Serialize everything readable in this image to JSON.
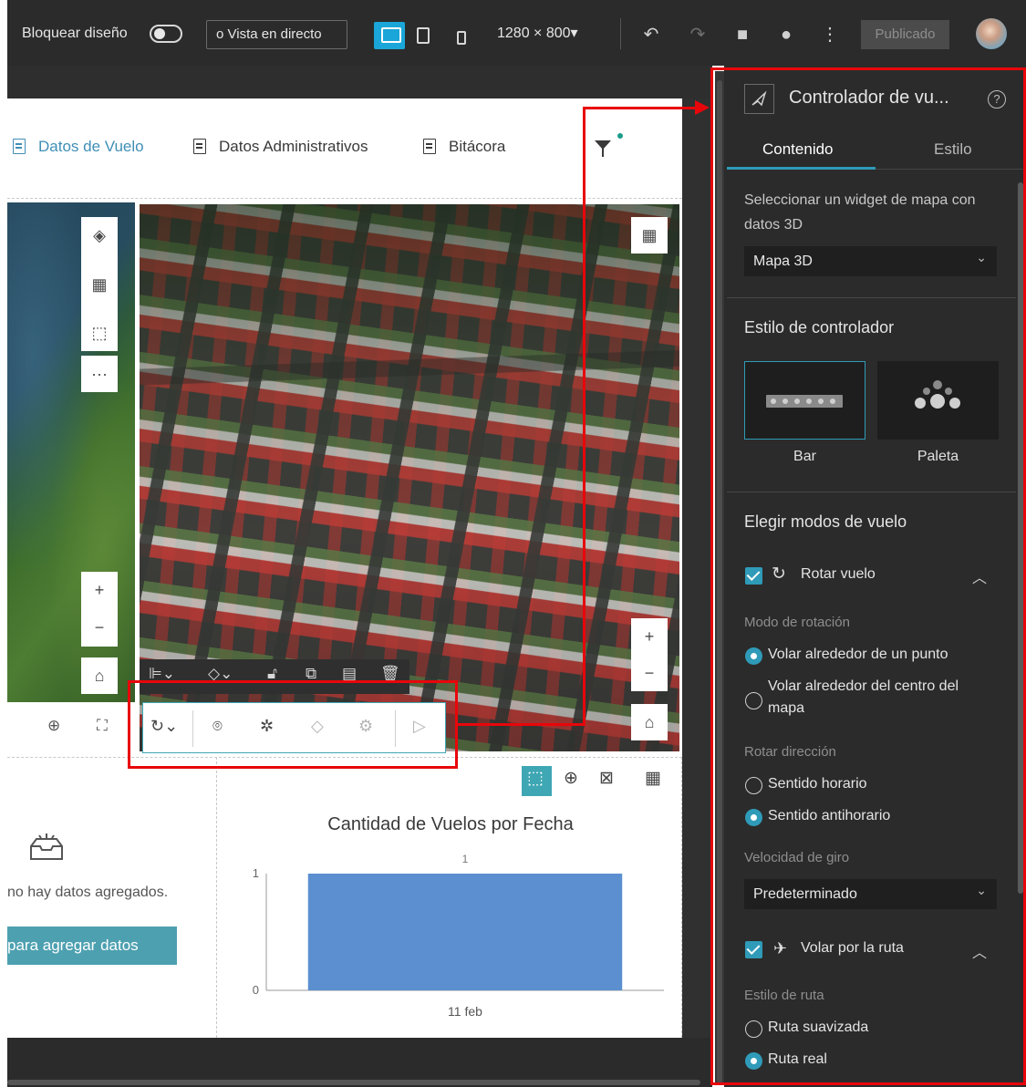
{
  "topbar": {
    "lock_layout_label": "Bloquear diseño",
    "live_view_label": "Vista en directo",
    "resolution_label": "1280 × 800▾",
    "published_label": "Publicado"
  },
  "page_tabs": [
    {
      "label": "Datos de Vuelo",
      "active": true
    },
    {
      "label": "Datos Administrativos",
      "active": false
    },
    {
      "label": "Bitácora",
      "active": false
    }
  ],
  "map_tools": {
    "more": "···",
    "zoom_in": "+",
    "zoom_out": "−"
  },
  "no_data": {
    "message": "no hay datos agregados.",
    "button_label": "para agregar datos"
  },
  "chart_data": {
    "type": "bar",
    "title": "Cantidad de Vuelos por Fecha",
    "categories": [
      "11 feb"
    ],
    "values": [
      1
    ],
    "data_labels": [
      "1"
    ],
    "y_ticks": [
      "0",
      "1"
    ],
    "ylim": [
      0,
      1
    ],
    "bar_color": "#5b8fd0",
    "grid": false,
    "legend": "none"
  },
  "panel": {
    "title": "Controlador de vu...",
    "tabs": [
      {
        "label": "Contenido",
        "active": true
      },
      {
        "label": "Estilo",
        "active": false
      }
    ],
    "map_select_label": "Seleccionar un widget de mapa con datos 3D",
    "map_select_value": "Mapa 3D",
    "controller_style_heading": "Estilo de controlador",
    "style_options": [
      {
        "label": "Bar",
        "selected": true
      },
      {
        "label": "Paleta",
        "selected": false
      }
    ],
    "flight_modes_heading": "Elegir modos de vuelo",
    "rotate_flight_label": "Rotar vuelo",
    "rotation_mode_label": "Modo de rotación",
    "rotation_options": [
      {
        "label": "Volar alrededor de un punto",
        "selected": true
      },
      {
        "label": "Volar alrededor del centro del mapa",
        "selected": false
      }
    ],
    "rotate_direction_label": "Rotar dirección",
    "direction_options": [
      {
        "label": "Sentido horario",
        "selected": false
      },
      {
        "label": "Sentido antihorario",
        "selected": true
      }
    ],
    "speed_label": "Velocidad de giro",
    "speed_value": "Predeterminado",
    "route_flight_label": "Volar por la ruta",
    "route_style_label": "Estilo de ruta",
    "route_options": [
      {
        "label": "Ruta suavizada",
        "selected": false
      },
      {
        "label": "Ruta real",
        "selected": true
      }
    ]
  },
  "colors": {
    "accent": "#2f9bb8",
    "annotation": "#e8060b",
    "button": "#4da0b0"
  }
}
